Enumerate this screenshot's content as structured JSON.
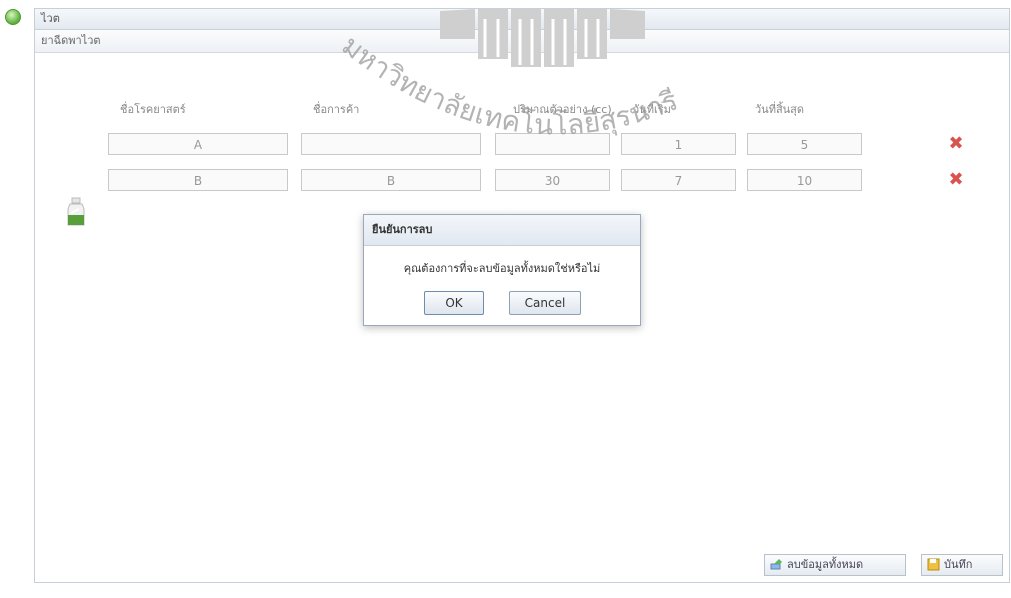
{
  "app": {
    "title": "ไวต",
    "panel_title": "ยาฉีดพาไวต"
  },
  "table": {
    "headers": [
      "ชื่อโรคยาสตร์",
      "ชื่อการค้า",
      "ปริมาณตัวอย่าง (cc)",
      "วันที่เริ่ม",
      "วันที่สิ้นสุด"
    ],
    "rows": [
      [
        "A",
        "",
        "",
        "1",
        "5"
      ],
      [
        "B",
        "B",
        "30",
        "7",
        "10"
      ]
    ]
  },
  "watermark": {
    "text": "มหาวิทยาลัยเทคโนโลยีสุรนารี"
  },
  "dialog": {
    "title": "ยืนยันการลบ",
    "message": "คุณต้องการที่จะลบข้อมูลทั้งหมดใช่หรือไม่",
    "ok_label": "OK",
    "cancel_label": "Cancel"
  },
  "footer": {
    "delete_all_label": "ลบข้อมูลทั้งหมด",
    "save_label": "บันทึก"
  },
  "icons": {
    "app": "green-circle-icon",
    "delete_row": "red-x-icon",
    "add_row": "green-bottle-icon",
    "delete_all": "eraser-icon",
    "save": "save-icon"
  },
  "colors": {
    "delete": "#d9534f",
    "accent": "#6cb84a"
  }
}
